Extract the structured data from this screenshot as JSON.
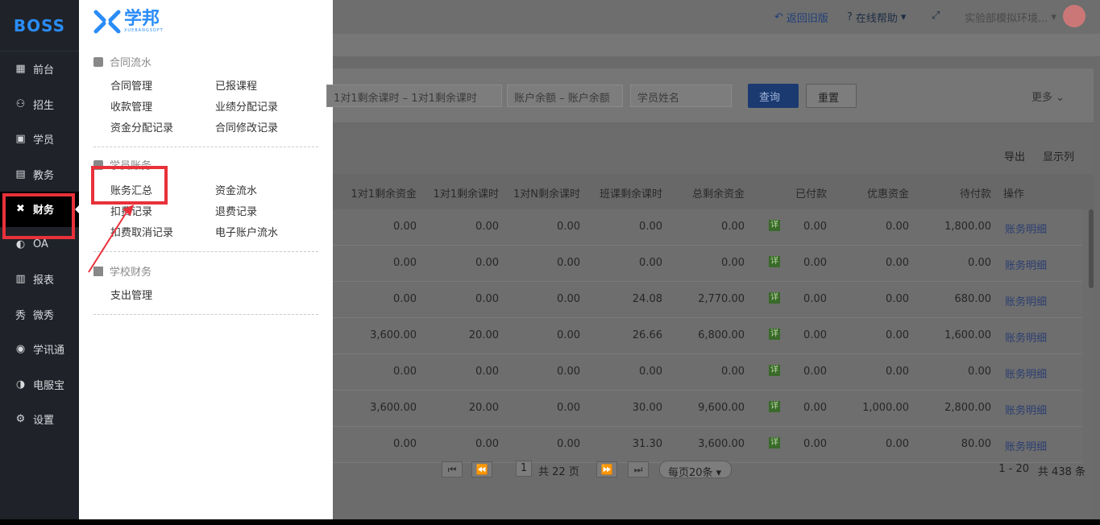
{
  "sidebar": {
    "logo": "BOSS",
    "items": [
      {
        "label": "前台",
        "icon": "calendar-icon"
      },
      {
        "label": "招生",
        "icon": "user-plus-icon"
      },
      {
        "label": "学员",
        "icon": "student-icon"
      },
      {
        "label": "教务",
        "icon": "book-icon"
      },
      {
        "label": "财务",
        "icon": "finance-icon",
        "active": true
      },
      {
        "label": "OA",
        "icon": "oa-icon"
      },
      {
        "label": "报表",
        "icon": "chart-icon"
      },
      {
        "label": "微秀",
        "icon": "show-icon"
      },
      {
        "label": "学讯通",
        "icon": "location-icon"
      },
      {
        "label": "电服宝",
        "icon": "phone-icon"
      },
      {
        "label": "设置",
        "icon": "gear-icon"
      }
    ]
  },
  "menu": {
    "brand": "学邦",
    "brand_sub": "XUEBANGSOFT",
    "section1": "合同流水",
    "section1_links": [
      "合同管理",
      "已报课程",
      "收款管理",
      "业绩分配记录",
      "资金分配记录",
      "合同修改记录"
    ],
    "section2": "学员账务",
    "section2_links": [
      "账务汇总",
      "资金流水",
      "扣费记录",
      "退费记录",
      "扣费取消记录",
      "电子账户流水"
    ],
    "section3": "学校财务",
    "section3_links": [
      "支出管理"
    ]
  },
  "topbar": {
    "back": "返回旧版",
    "help": "在线帮助",
    "account": "实验部模拟环境..."
  },
  "filters": {
    "range1": "1对1剩余课时  –  1对1剩余课时",
    "range2": "账户余额  –  账户余额",
    "name_placeholder": "学员姓名",
    "query": "查询",
    "reset": "重置",
    "more": "更多"
  },
  "table": {
    "tools": [
      "导出",
      "显示列"
    ],
    "headers": [
      "1对1剩余资金",
      "1对1剩余课时",
      "1对N剩余课时",
      "班课剩余课时",
      "总剩余资金",
      "已付款",
      "优惠资金",
      "待付款",
      "操作"
    ],
    "detail_label": "详",
    "op_label": "账务明细",
    "rows": [
      [
        "0.00",
        "0.00",
        "0.00",
        "0.00",
        "0.00",
        "0.00",
        "0.00",
        "1,800.00"
      ],
      [
        "0.00",
        "0.00",
        "0.00",
        "0.00",
        "0.00",
        "0.00",
        "0.00",
        "0.00"
      ],
      [
        "0.00",
        "0.00",
        "0.00",
        "24.08",
        "2,770.00",
        "0.00",
        "0.00",
        "680.00"
      ],
      [
        "3,600.00",
        "20.00",
        "0.00",
        "26.66",
        "6,800.00",
        "0.00",
        "0.00",
        "1,600.00"
      ],
      [
        "0.00",
        "0.00",
        "0.00",
        "0.00",
        "0.00",
        "0.00",
        "0.00",
        "0.00"
      ],
      [
        "3,600.00",
        "20.00",
        "0.00",
        "30.00",
        "9,600.00",
        "0.00",
        "1,000.00",
        "2,800.00"
      ],
      [
        "0.00",
        "0.00",
        "0.00",
        "31.30",
        "3,600.00",
        "0.00",
        "0.00",
        "80.00"
      ]
    ]
  },
  "pager": {
    "page": "1",
    "total_pages": "共 22 页",
    "per_page": "每页20条",
    "range": "1 - 20",
    "total": "共 438 条"
  }
}
